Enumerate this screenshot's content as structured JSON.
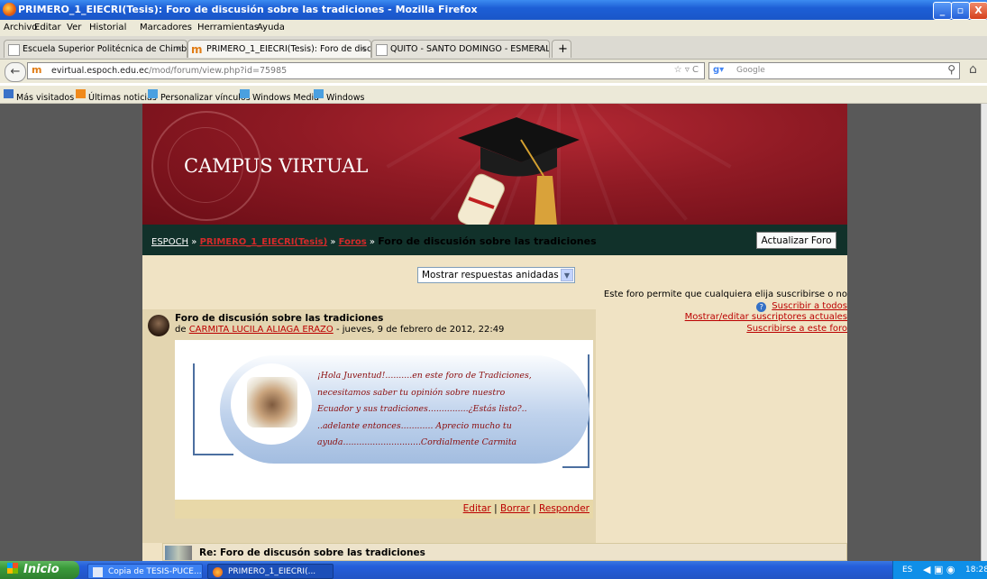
{
  "window": {
    "title": "PRIMERO_1_EIECRI(Tesis): Foro de discusión sobre las tradiciones - Mozilla Firefox",
    "minimize": "_",
    "maximize": "▫",
    "close": "X"
  },
  "menu": [
    "Archivo",
    "Editar",
    "Ver",
    "Historial",
    "Marcadores",
    "Herramientas",
    "Ayuda"
  ],
  "tabs": [
    {
      "label": "Escuela Superior Politécnica de Chimborazo",
      "active": false
    },
    {
      "label": "PRIMERO_1_EIECRI(Tesis): Foro de disc...",
      "active": true
    },
    {
      "label": "QUITO - SANTO DOMINGO - ESMERALDA...",
      "active": false
    }
  ],
  "tab_new": "+",
  "nav": {
    "site_icon": "m",
    "url_domain": "evirtual.espoch.edu.ec",
    "url_path": "/mod/forum/view.php?id=75985",
    "search_engine": "Google",
    "search_placeholder": "Google"
  },
  "bookmarks": [
    "Más visitados",
    "Últimas noticias",
    "Personalizar vínculos",
    "Windows Media",
    "Windows"
  ],
  "site": {
    "banner_title": "CAMPUS VIRTUAL",
    "breadcrumb": {
      "home": "ESPOCH",
      "sep": "»",
      "course": "PRIMERO_1_EIECRI(Tesis)",
      "section": "Foros",
      "current": "Foro de discusión sobre las tradiciones"
    },
    "update_button": "Actualizar Foro"
  },
  "display_mode": {
    "selected": "Mostrar respuestas anidadas"
  },
  "subscription": {
    "info": "Este foro permite que cualquiera elija suscribirse o no",
    "subscribe_all": "Suscribir a todos",
    "show_edit": "Mostrar/editar suscriptores actuales",
    "subscribe_forum": "Suscribirse a este foro"
  },
  "post": {
    "title": "Foro de discusión sobre las tradiciones",
    "by_prefix": "de",
    "author": "CARMITA LUCILA ALIAGA ERAZO",
    "date": "- jueves, 9 de febrero de 2012, 22:49",
    "message_lines": [
      "¡Hola Juventud!..........en este foro de Tradiciones,",
      "necesitamos saber tu opinión sobre nuestro",
      "Ecuador y sus tradiciones...............¿Estás listo?..",
      "..adelante entonces............ Aprecio mucho tu",
      "ayuda.............................Cordialmente Carmita"
    ],
    "actions": {
      "edit": "Editar",
      "delete": "Borrar",
      "reply": "Responder",
      "sep": "|"
    }
  },
  "reply": {
    "title": "Re: Foro de discusón sobre las tradiciones"
  },
  "taskbar": {
    "start": "Inicio",
    "items": [
      "Copia de TESIS-PUCE...",
      "PRIMERO_1_EIECRI(..."
    ],
    "lang": "ES",
    "time": "18:28"
  },
  "colors": {
    "banner": "#8f1a24",
    "crumb_bar": "#11312a",
    "link_red": "#bb0000",
    "post_bg": "#e3d5b0"
  }
}
